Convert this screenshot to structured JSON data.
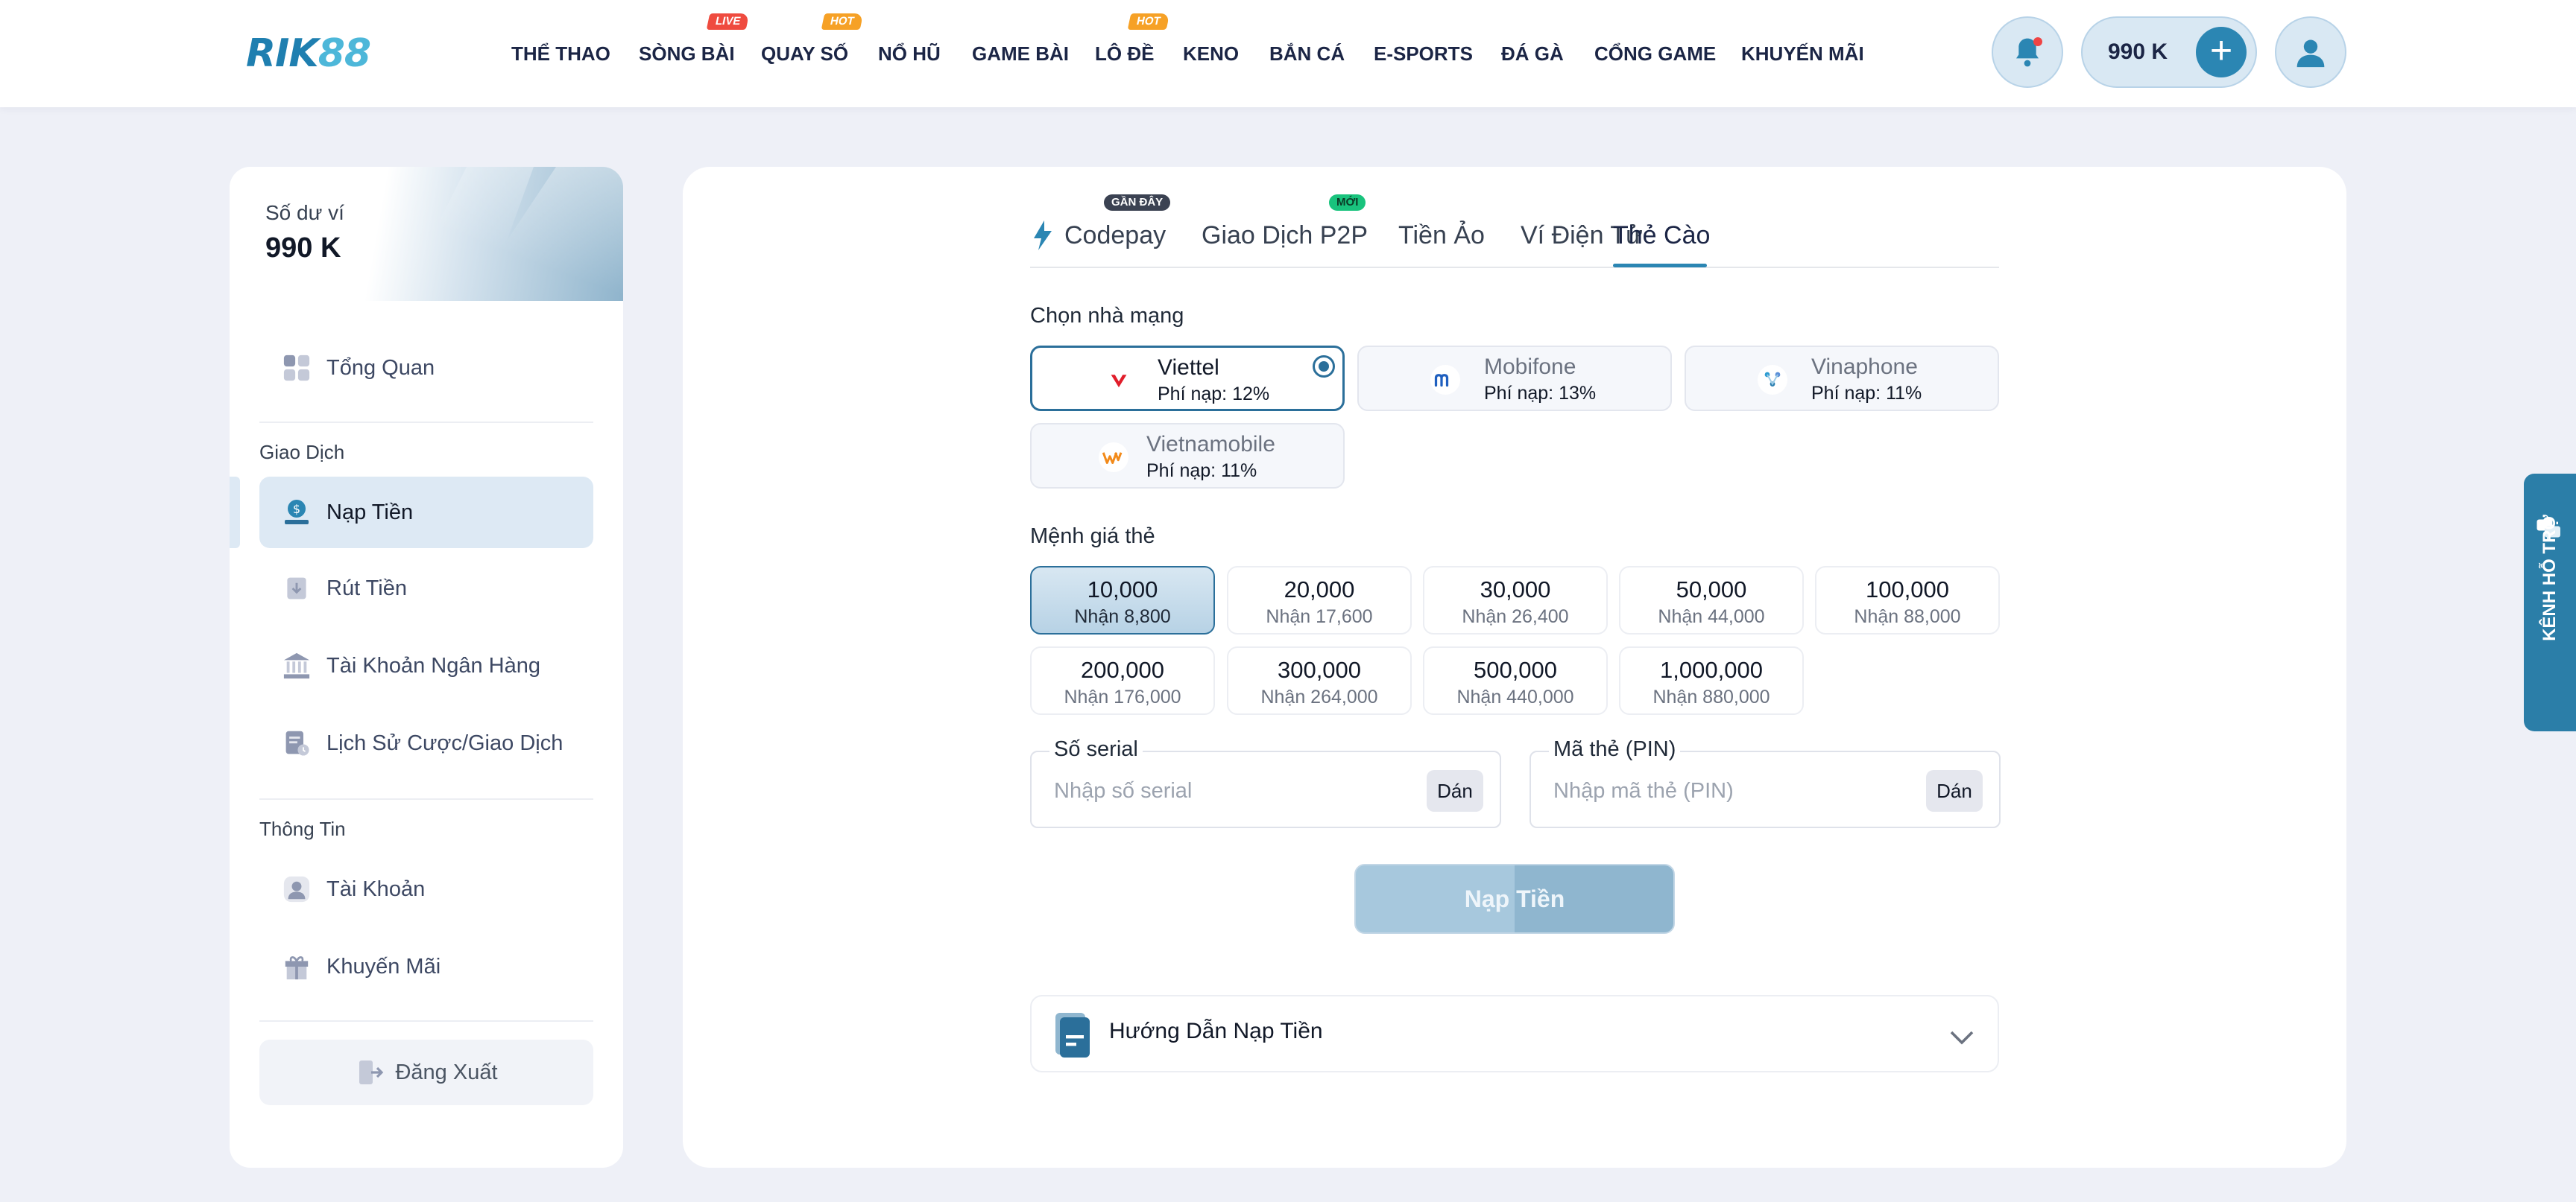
{
  "header": {
    "logo_main": "RIK",
    "logo_accent": "88",
    "nav": [
      {
        "label": "THỂ THAO",
        "badge": ""
      },
      {
        "label": "SÒNG BÀI",
        "badge": "LIVE"
      },
      {
        "label": "QUAY SỐ",
        "badge": "HOT"
      },
      {
        "label": "NỔ HŨ",
        "badge": ""
      },
      {
        "label": "GAME BÀI",
        "badge": ""
      },
      {
        "label": "LÔ ĐỀ",
        "badge": "HOT"
      },
      {
        "label": "KENO",
        "badge": ""
      },
      {
        "label": "BẮN CÁ",
        "badge": ""
      },
      {
        "label": "E-SPORTS",
        "badge": ""
      },
      {
        "label": "ĐÁ GÀ",
        "badge": ""
      },
      {
        "label": "CỔNG GAME",
        "badge": ""
      },
      {
        "label": "KHUYẾN MÃI",
        "badge": ""
      }
    ],
    "balance": "990 K",
    "icons": {
      "bell": "bell-icon",
      "add": "plus-icon",
      "user": "user-icon"
    }
  },
  "sidebar": {
    "wallet_label": "Số dư ví",
    "wallet_value": "990 K",
    "overview": "Tổng Quan",
    "section_transactions": "Giao Dịch",
    "deposit": "Nạp Tiền",
    "withdraw": "Rút Tiền",
    "bank_account": "Tài Khoản Ngân Hàng",
    "history": "Lịch Sử Cược/Giao Dịch",
    "section_info": "Thông Tin",
    "account": "Tài Khoản",
    "promotions": "Khuyến Mãi",
    "logout": "Đăng Xuất"
  },
  "tabs": [
    {
      "label": "Codepay",
      "badge": "GẦN ĐÂY"
    },
    {
      "label": "Giao Dịch P2P",
      "badge": "MỚI"
    },
    {
      "label": "Tiền Ảo",
      "badge": ""
    },
    {
      "label": "Ví Điện Tử",
      "badge": ""
    },
    {
      "label": "Thẻ Cào",
      "badge": "",
      "active": true
    }
  ],
  "carrier_section_label": "Chọn nhà mạng",
  "carriers": [
    {
      "name": "Viettel",
      "fee": "Phí nạp: 12%",
      "selected": true
    },
    {
      "name": "Mobifone",
      "fee": "Phí nạp: 13%",
      "selected": false
    },
    {
      "name": "Vinaphone",
      "fee": "Phí nạp: 11%",
      "selected": false
    },
    {
      "name": "Vietnamobile",
      "fee": "Phí nạp: 11%",
      "selected": false
    }
  ],
  "denomination_section_label": "Mệnh giá thẻ",
  "denominations": [
    {
      "value": "10,000",
      "receive": "Nhận 8,800",
      "selected": true
    },
    {
      "value": "20,000",
      "receive": "Nhận 17,600"
    },
    {
      "value": "30,000",
      "receive": "Nhận 26,400"
    },
    {
      "value": "50,000",
      "receive": "Nhận 44,000"
    },
    {
      "value": "100,000",
      "receive": "Nhận 88,000"
    },
    {
      "value": "200,000",
      "receive": "Nhận 176,000"
    },
    {
      "value": "300,000",
      "receive": "Nhận 264,000"
    },
    {
      "value": "500,000",
      "receive": "Nhận 440,000"
    },
    {
      "value": "1,000,000",
      "receive": "Nhận 880,000"
    }
  ],
  "serial": {
    "label": "Số serial",
    "placeholder": "Nhập số serial",
    "value": "",
    "paste": "Dán"
  },
  "pin": {
    "label": "Mã thẻ (PIN)",
    "placeholder": "Nhập mã thẻ (PIN)",
    "value": "",
    "paste": "Dán"
  },
  "submit_label": "Nạp Tiền",
  "guide_label": "Hướng Dẫn Nạp Tiền",
  "support_label": "KÊNH HỖ TRỢ",
  "colors": {
    "accent": "#2b86b3",
    "selected_border": "#2b6f9a",
    "viettel": "#e11d2a",
    "mobifone": "#1f5fbf",
    "vietnamobile": "#f28a1a"
  }
}
